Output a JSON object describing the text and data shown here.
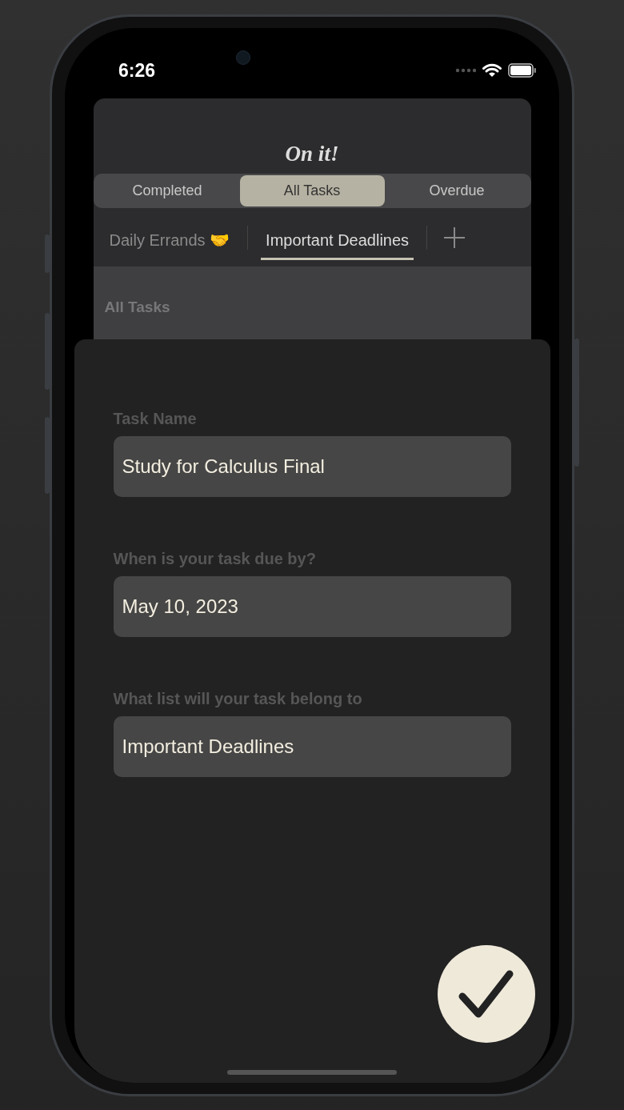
{
  "status_bar": {
    "time": "6:26"
  },
  "app": {
    "title": "On it!",
    "filter_segments": [
      {
        "label": "Completed",
        "selected": false
      },
      {
        "label": "All Tasks",
        "selected": true
      },
      {
        "label": "Overdue",
        "selected": false
      }
    ],
    "list_tabs": [
      {
        "label": "Daily Errands 🤝",
        "selected": false
      },
      {
        "label": "Important Deadlines",
        "selected": true
      }
    ],
    "section_header": "All Tasks"
  },
  "sheet": {
    "fields": [
      {
        "label": "Task Name",
        "value": "Study for Calculus Final"
      },
      {
        "label": "When is your task due by?",
        "value": "May 10, 2023"
      },
      {
        "label": "What list will your task belong to",
        "value": "Important Deadlines"
      }
    ]
  }
}
